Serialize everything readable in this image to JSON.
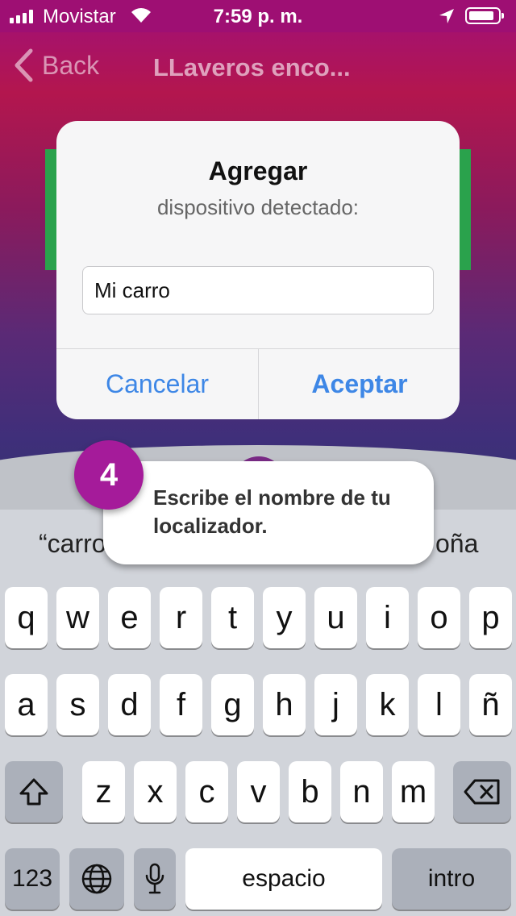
{
  "status_bar": {
    "carrier": "Movistar",
    "time": "7:59 p. m.",
    "signal_bars": 4,
    "battery_level": 0.75
  },
  "nav": {
    "back_label": "Back",
    "title": "LLaveros enco..."
  },
  "dialog": {
    "title": "Agregar",
    "subtitle": "dispositivo detectado:",
    "input_value": "Mi carro",
    "cancel_label": "Cancelar",
    "accept_label": "Aceptar",
    "button_color": "#3e87e6"
  },
  "tooltip": {
    "step_number": "4",
    "text": "Escribe el nombre de tu localizador.",
    "step_color": "#a51b9a"
  },
  "suggestions": {
    "left": "“carro",
    "right": "oña"
  },
  "keyboard": {
    "row1": [
      "q",
      "w",
      "e",
      "r",
      "t",
      "y",
      "u",
      "i",
      "o",
      "p"
    ],
    "row2": [
      "a",
      "s",
      "d",
      "f",
      "g",
      "h",
      "j",
      "k",
      "l",
      "ñ"
    ],
    "row3": [
      "z",
      "x",
      "c",
      "v",
      "b",
      "n",
      "m"
    ],
    "numbers_label": "123",
    "space_label": "espacio",
    "return_label": "intro",
    "icons": [
      "shift-icon",
      "backspace-icon",
      "globe-icon",
      "microphone-icon"
    ]
  }
}
